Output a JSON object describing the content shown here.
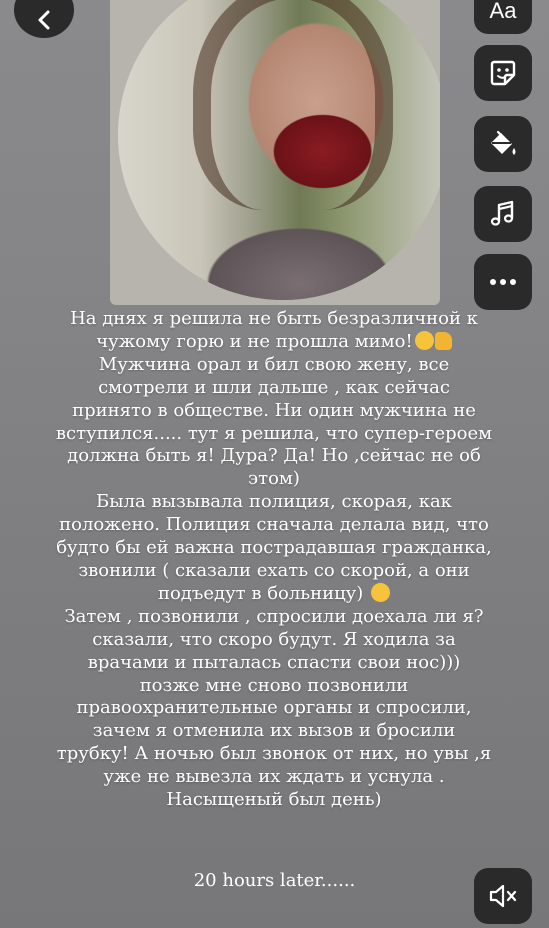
{
  "toolbar": {
    "text_label": "Aa",
    "icons": [
      "back-icon",
      "text-icon",
      "sticker-icon",
      "paint-bucket-icon",
      "music-icon",
      "more-icon",
      "mute-icon"
    ]
  },
  "story": {
    "lines": [
      "На днях я решила не быть безразличной к",
      "чужому горю и не прошла мимо!",
      "Мужчина орал и бил свою жену, все",
      "смотрели и шли дальше , как сейчас",
      "принято в обществе. Ни один мужчина не",
      "вступился..... тут я решила, что супер-героем",
      "должна быть я! Дура? Да! Но ,сейчас не об",
      "этом)",
      "Была вызывала полиция, скорая, как",
      "положено. Полиция сначала делала вид, что",
      "будто бы ей важна пострадавшая гражданка,",
      "звонили ( сказали ехать со скорой, а они",
      "подъедут в больницу)",
      "Затем , позвонили , спросили доехала ли я?",
      "сказали, что скоро будут. Я ходила за",
      "врачами и пыталась спасти свои нос)))",
      "позже мне сново позвонили",
      "правоохранительные органы и спросили,",
      "зачем я отменила их вызов и бросили",
      "трубку! А ночью был звонок от них, но увы ,я",
      "уже не вывезла их ждать и уснула .",
      "Насыщеный был день)"
    ],
    "footer": "20 hours later......"
  }
}
